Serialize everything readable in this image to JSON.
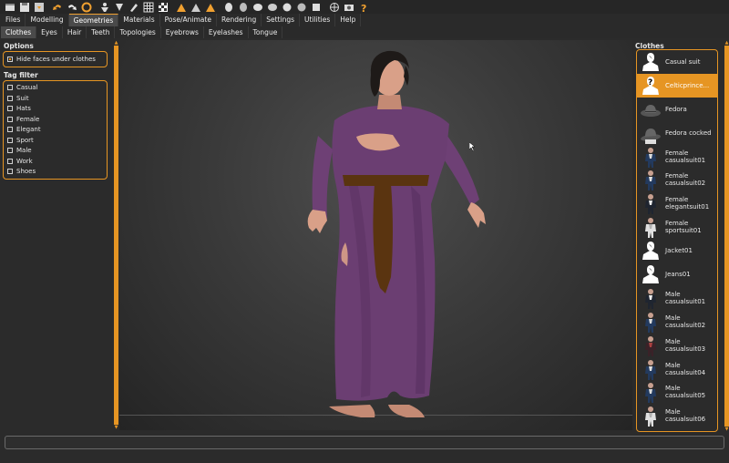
{
  "toolbar": {
    "buttons": [
      {
        "icon": "window-icon"
      },
      {
        "icon": "save-icon"
      },
      {
        "icon": "load-icon"
      },
      {
        "icon": "undo-icon"
      },
      {
        "icon": "redo-icon"
      },
      {
        "icon": "reset-icon"
      },
      {
        "icon": "pose-icon"
      },
      {
        "icon": "symmetry-icon"
      },
      {
        "icon": "brush-icon"
      },
      {
        "icon": "grid-icon"
      },
      {
        "icon": "checker-icon"
      },
      {
        "icon": "view-front-icon"
      },
      {
        "icon": "view-back-icon"
      },
      {
        "icon": "view-left-icon"
      },
      {
        "icon": "head-front-icon"
      },
      {
        "icon": "head-back-icon"
      },
      {
        "icon": "head-left-icon"
      },
      {
        "icon": "head-right-icon"
      },
      {
        "icon": "head-top-icon"
      },
      {
        "icon": "head-bottom-icon"
      },
      {
        "icon": "reset-camera-icon"
      },
      {
        "icon": "wireframe-icon"
      },
      {
        "icon": "screenshot-icon"
      },
      {
        "icon": "help-icon"
      }
    ]
  },
  "main_tabs": [
    "Files",
    "Modelling",
    "Geometries",
    "Materials",
    "Pose/Animate",
    "Rendering",
    "Settings",
    "Utilities",
    "Help"
  ],
  "active_main_tab": "Geometries",
  "sub_tabs": [
    "Clothes",
    "Eyes",
    "Hair",
    "Teeth",
    "Topologies",
    "Eyebrows",
    "Eyelashes",
    "Tongue"
  ],
  "active_sub_tab": "Clothes",
  "options": {
    "title": "Options",
    "hide_faces": {
      "label": "Hide faces under clothes",
      "checked": true
    }
  },
  "tag_filter": {
    "title": "Tag filter",
    "tags": [
      "Casual",
      "Suit",
      "Hats",
      "Female",
      "Elegant",
      "Sport",
      "Male",
      "Work",
      "Shoes"
    ]
  },
  "clothes": {
    "title": "Clothes",
    "items": [
      {
        "label": "Casual suit",
        "thumb": "silhouette",
        "selected": false
      },
      {
        "label": "Celticprince...",
        "thumb": "unknown",
        "selected": true
      },
      {
        "label": "Fedora",
        "thumb": "hat",
        "selected": false
      },
      {
        "label": "Fedora cocked",
        "thumb": "hat-cocked",
        "selected": false
      },
      {
        "label": "Female\ncasualsuit01",
        "thumb": "suit-blue",
        "selected": false
      },
      {
        "label": "Female\ncasualsuit02",
        "thumb": "suit-blue",
        "selected": false
      },
      {
        "label": "Female\nelegantsuit01",
        "thumb": "suit-dark",
        "selected": false
      },
      {
        "label": "Female\nsportsuit01",
        "thumb": "suit-white",
        "selected": false
      },
      {
        "label": "Jacket01",
        "thumb": "silhouette",
        "selected": false
      },
      {
        "label": "Jeans01",
        "thumb": "silhouette",
        "selected": false
      },
      {
        "label": "Male\ncasualsuit01",
        "thumb": "suit-dark",
        "selected": false
      },
      {
        "label": "Male\ncasualsuit02",
        "thumb": "suit-blue",
        "selected": false
      },
      {
        "label": "Male\ncasualsuit03",
        "thumb": "suit-red",
        "selected": false
      },
      {
        "label": "Male\ncasualsuit04",
        "thumb": "suit-blue",
        "selected": false
      },
      {
        "label": "Male\ncasualsuit05",
        "thumb": "suit-blue",
        "selected": false
      },
      {
        "label": "Male\ncasualsuit06",
        "thumb": "suit-white",
        "selected": false
      }
    ]
  },
  "colors": {
    "accent": "#e69523",
    "background": "#2b2b2b",
    "robe": "#6b3e72",
    "belt": "#5a3410",
    "skin": "#d9a088",
    "hair": "#1e1a18"
  }
}
